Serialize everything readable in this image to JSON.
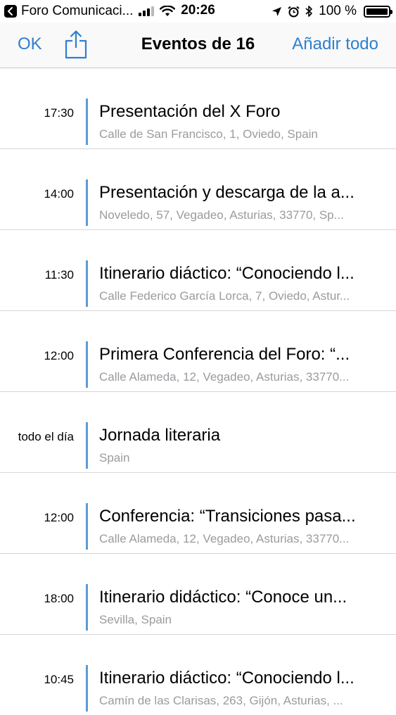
{
  "status_bar": {
    "app_name": "Foro Comunicaci...",
    "time": "20:26",
    "battery_text": "100 %",
    "battery_level": 1.0
  },
  "nav": {
    "ok_label": "OK",
    "title": "Eventos de 16",
    "add_all_label": "Añadir todo"
  },
  "colors": {
    "accent": "#2e7fcf",
    "event_bar": "#5b9bd5",
    "secondary_text": "#9b9ba0"
  },
  "icons": {
    "back": "back-arrow-icon",
    "signal": "cellular-signal-icon",
    "wifi": "wifi-icon",
    "location": "location-arrow-icon",
    "alarm": "alarm-clock-icon",
    "bluetooth": "bluetooth-icon",
    "battery": "battery-icon",
    "share": "share-icon"
  },
  "events": [
    {
      "time": "17:30",
      "title": "Presentación del X Foro",
      "location": "Calle de San Francisco, 1, Oviedo, Spain"
    },
    {
      "time": "14:00",
      "title": "Presentación y descarga de la a...",
      "location": "Noveledo, 57, Vegadeo, Asturias, 33770, Sp..."
    },
    {
      "time": "11:30",
      "title": "Itinerario diáctico: “Conociendo l...",
      "location": "Calle Federico García Lorca, 7, Oviedo, Astur..."
    },
    {
      "time": "12:00",
      "title": "Primera Conferencia del Foro: “...",
      "location": "Calle Alameda, 12, Vegadeo, Asturias, 33770..."
    },
    {
      "time": "todo el día",
      "title": "Jornada literaria",
      "location": "Spain"
    },
    {
      "time": "12:00",
      "title": "Conferencia: “Transiciones pasa...",
      "location": "Calle Alameda, 12, Vegadeo, Asturias, 33770..."
    },
    {
      "time": "18:00",
      "title": "Itinerario didáctico: “Conoce un...",
      "location": "Sevilla, Spain"
    },
    {
      "time": "10:45",
      "title": "Itinerario diáctico: “Conociendo l...",
      "location": "Camín de las Clarisas, 263, Gijón, Asturias, ..."
    }
  ]
}
